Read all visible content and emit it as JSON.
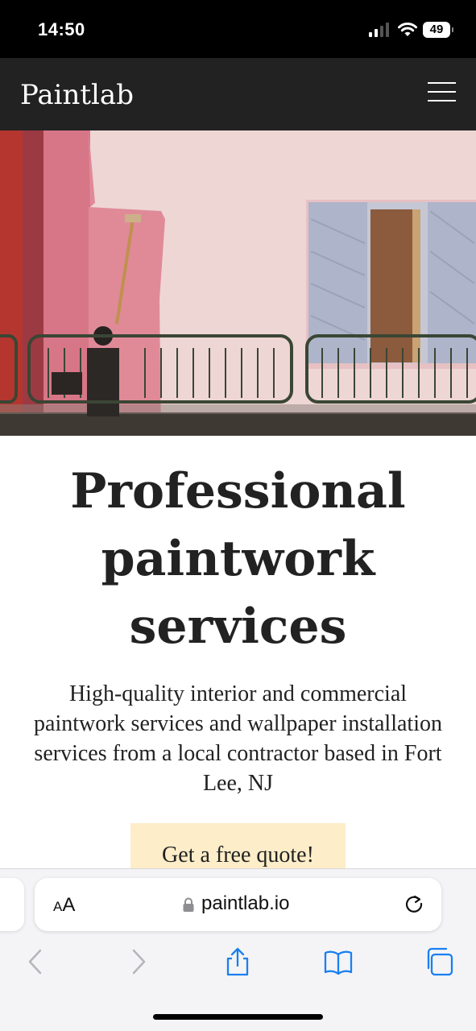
{
  "status_bar": {
    "time": "14:50",
    "battery": "49"
  },
  "header": {
    "brand": "Paintlab",
    "menu_icon": "hamburger-icon"
  },
  "hero": {
    "image_description": "pink-wall-painter-photo"
  },
  "main": {
    "headline": "Professional paintwork services",
    "subtext": "High-quality interior and commercial paintwork services and wallpaper installation services from a local contractor based in Fort Lee, NJ",
    "cta_label": "Get a free quote!"
  },
  "browser": {
    "text_size_label_small": "A",
    "text_size_label_large": "A",
    "url": "paintlab.io",
    "icons": [
      "lock-icon",
      "reload-icon",
      "back-icon",
      "forward-icon",
      "share-icon",
      "bookmarks-icon",
      "tabs-icon"
    ]
  },
  "colors": {
    "header_bg": "#222222",
    "cta_bg": "#fdedc8",
    "accent_blue": "#1a7ff0",
    "wall_pink": "#ead0cf",
    "painted_pink": "#e08a98"
  }
}
